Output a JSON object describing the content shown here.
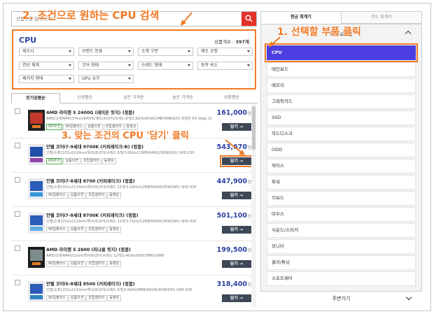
{
  "search": {
    "placeholder": "상품명을 입력하세요"
  },
  "filter": {
    "title": "CPU",
    "count_label": "상품개수 : ",
    "count_value": "397개",
    "dropdowns": [
      "제조사",
      "브랜드 분류",
      "소켓 구분",
      "제조 공정",
      "연산 체계",
      "코어 형태",
      "쓰레드 형태",
      "동작 속도",
      "패키지 형태",
      "GPU 유무"
    ]
  },
  "sort_tabs": [
    "인기상품순",
    "신상품순",
    "낮은 가격순",
    "높은 가격순",
    "상품평순"
  ],
  "products": [
    {
      "name": "AMD 라이젠 5 2400G (레이븐 릿지) (정품)",
      "spec": "AMD(소켓AM4)/14nm/64비트/쿼드(4)코어/쓰레드 8개/3.6GHz/65W/2MB/4MB/GPU 라데온 RX Vega 11",
      "tags": [
        "MD추천",
        "90일플러스",
        "상품의견",
        "조립갤러리",
        "동영상"
      ],
      "price": "161,000",
      "won": "원",
      "cart": "담기 →"
    },
    {
      "name": "인텔 코어i7-9세대 9700K (커피레이크-R) (정품)",
      "spec": "인텔(소켓1151v2)/14nm/옥타(8)코어/쓰레드 8개/3.6GHz/12MB/64비트/95W/GPU UHD 630",
      "tags": [
        "MD추천",
        "상품의견",
        "조립갤러리",
        "동영상"
      ],
      "price": "543,670",
      "won": "원",
      "cart": "담기 →"
    },
    {
      "name": "인텔 코어i7-8세대 8700 (커피레이크) (정품)",
      "spec": "인텔(소켓1151v2)/14nm/헥사(6)코어/쓰레드 12개/3.2GHz/12MB/64비트/65W/GPU UHD 630",
      "tags": [
        "90일플러스",
        "상품의견",
        "조립갤러리",
        "동영상"
      ],
      "price": "447,900",
      "won": "원",
      "cart": "담기 →"
    },
    {
      "name": "인텔 코어i7-8세대 8700K (커피레이크) (정품)",
      "spec": "인텔(소켓1151v2)/14nm/헥사(6)코어/쓰레드 12개/3.7GHz/12MB/64비트/95W/GPU UHD 630",
      "tags": [
        "90일플러스",
        "상품의견",
        "조립갤러리",
        "동영상"
      ],
      "price": "501,100",
      "won": "원",
      "cart": "담기 →"
    },
    {
      "name": "AMD 라이젠 5 2600 (피나클 릿지) (정품)",
      "spec": "AMD(소켓AM4)/12nm/헥사(6)코어/쓰레드 12개/3.4GHz/65W/3MB/16MB",
      "tags": [
        "90일플러스",
        "상품의견",
        "조립갤러리",
        "동영상"
      ],
      "price": "199,500",
      "won": "원",
      "cart": "담기 →"
    },
    {
      "name": "인텔 코어i5-8세대 8500 (커피레이크) (정품)",
      "spec": "인텔(소켓1151v2)/14nm/헥사(6)코어/쓰레드 6개/3.0GHz/9MB/64비트/65W/GPU UHD 630",
      "tags": [
        "90일플러스",
        "상품의견",
        "조립갤러리",
        "동영상"
      ],
      "price": "318,400",
      "won": "원",
      "cart": "담기 →"
    }
  ],
  "right_tabs": [
    "현금 회계기",
    "카드 회계기"
  ],
  "category_header": "PC주요부품",
  "categories": [
    "CPU",
    "메인보드",
    "메모리",
    "그래픽카드",
    "SSD",
    "하드디스크",
    "ODD",
    "케이스",
    "파워",
    "키보드",
    "마우스",
    "사운드/스피커",
    "모니터",
    "쿨러/튜닝",
    "소프트웨어"
  ],
  "peripheral_label": "주변기기",
  "annotations": {
    "step1": "1. 선택할 부품 클릭",
    "step2": "2. 조건으로 원하는 CPU 검색",
    "step3": "3. 맞는 조건의 CPU '담기' 클릭"
  },
  "colors": {
    "accent_orange": "#f07a25",
    "selected_purple": "#4c3ee0",
    "price_blue": "#2a3fa3",
    "search_red": "#e2322a",
    "cart_dark": "#3d4756"
  }
}
